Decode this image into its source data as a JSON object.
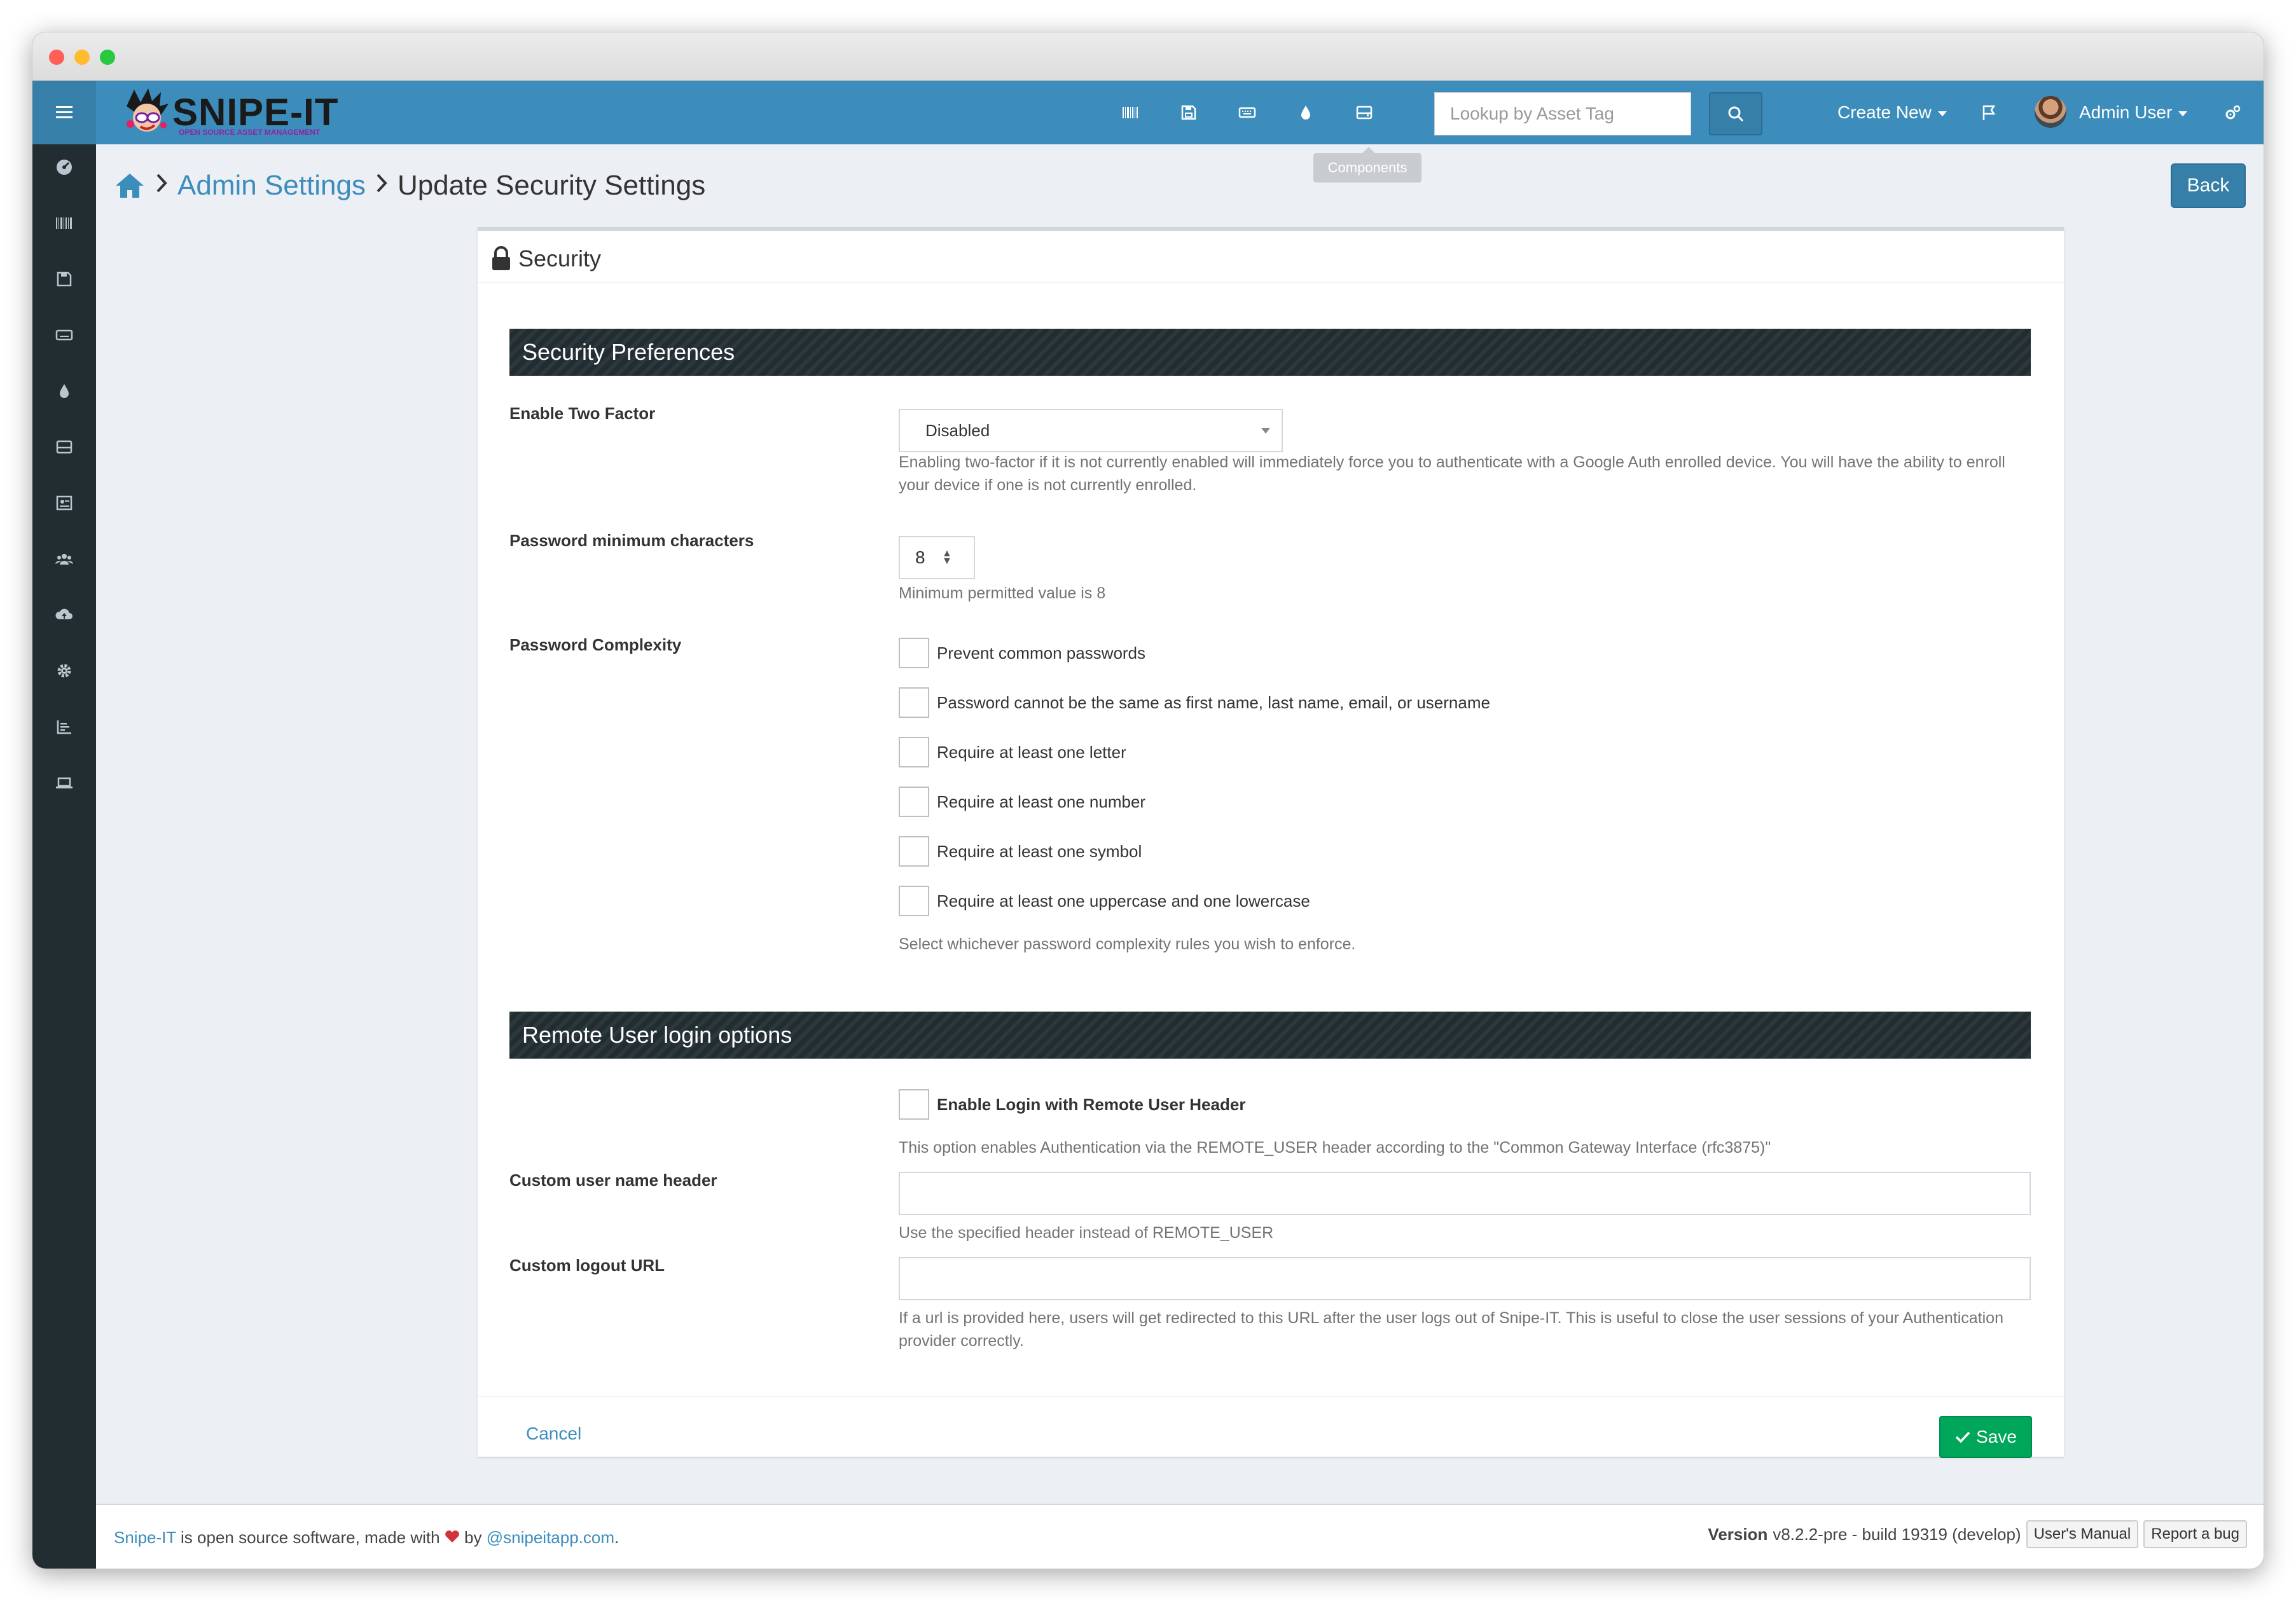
{
  "colors": {
    "nav_blue": "#3c8dbc",
    "nav_dark_blue": "#367fa9",
    "sidebar": "#222d32",
    "section_bar": "#222d32",
    "save_green": "#00a65a",
    "link": "#3c8dbc"
  },
  "header": {
    "logo_text": "SNIPE-IT",
    "logo_subtext": "OPEN SOURCE ASSET MANAGEMENT",
    "nav_icons": [
      "barcode-icon",
      "save-icon",
      "keyboard-icon",
      "tint-icon",
      "hdd-icon"
    ],
    "search_placeholder": "Lookup by Asset Tag",
    "create_new": "Create New",
    "user_name": "Admin User",
    "tooltip": "Components"
  },
  "sidebar": {
    "icons": [
      "dashboard-icon",
      "barcode-icon",
      "save-icon",
      "keyboard-icon",
      "tint-icon",
      "hdd-icon",
      "license-icon",
      "users-icon",
      "cloud-upload-icon",
      "settings-icon",
      "reports-icon",
      "laptop-icon"
    ]
  },
  "breadcrumb": {
    "parent": "Admin Settings",
    "current": "Update Security Settings"
  },
  "back_label": "Back",
  "panel": {
    "title": "Security",
    "section1": "Security Preferences",
    "two_factor": {
      "label": "Enable Two Factor",
      "value": "Disabled",
      "help": "Enabling two-factor if it is not currently enabled will immediately force you to authenticate with a Google Auth enrolled device. You will have the ability to enroll your device if one is not currently enrolled."
    },
    "pw_min": {
      "label": "Password minimum characters",
      "value": "8",
      "help": "Minimum permitted value is 8"
    },
    "complexity": {
      "label": "Password Complexity",
      "options": [
        "Prevent common passwords",
        "Password cannot be the same as first name, last name, email, or username",
        "Require at least one letter",
        "Require at least one number",
        "Require at least one symbol",
        "Require at least one uppercase and one lowercase"
      ],
      "help": "Select whichever password complexity rules you wish to enforce."
    },
    "section2": "Remote User login options",
    "remote": {
      "checkbox_label": "Enable Login with Remote User Header",
      "help": "This option enables Authentication via the REMOTE_USER header according to the \"Common Gateway Interface (rfc3875)\""
    },
    "custom_header": {
      "label": "Custom user name header",
      "value": "",
      "help": "Use the specified header instead of REMOTE_USER"
    },
    "logout_url": {
      "label": "Custom logout URL",
      "value": "",
      "help": "If a url is provided here, users will get redirected to this URL after the user logs out of Snipe-IT. This is useful to close the user sessions of your Authentication provider correctly."
    },
    "cancel": "Cancel",
    "save": "Save"
  },
  "footer": {
    "brand": "Snipe-IT",
    "text1": "is open source software, made with",
    "text2": "by",
    "handle": "@snipeitapp.com",
    "period": ".",
    "version_label": "Version",
    "version_value": "v8.2.2-pre - build 19319 (develop)",
    "manual": "User's Manual",
    "bug": "Report a bug"
  }
}
